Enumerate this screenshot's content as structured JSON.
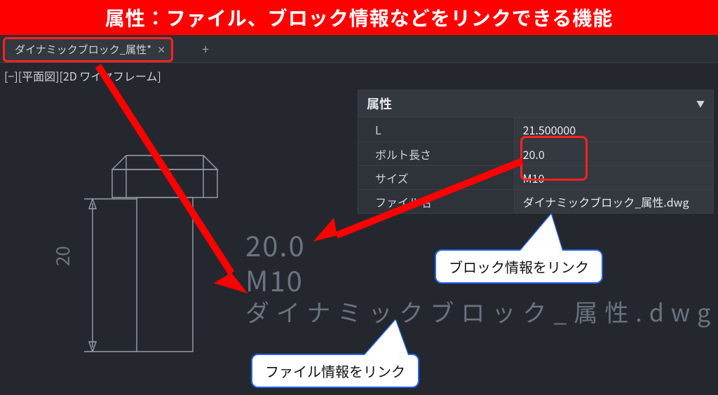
{
  "title_bar": "属性：ファイル、ブロック情報などをリンクできる機能",
  "tabs": {
    "items": [
      {
        "label": "ダイナミックブロック_属性*"
      }
    ],
    "add": "+"
  },
  "viewport_label": "[−][平面図][2D ワイヤフレーム]",
  "attr_panel": {
    "title": "属性",
    "rows": [
      {
        "key": "L",
        "val": "21.500000"
      },
      {
        "key": "ボルト長さ",
        "val": "20.0"
      },
      {
        "key": "サイズ",
        "val": "M10"
      },
      {
        "key": "ファイル名",
        "val": "ダイナミックブロック_属性.dwg"
      }
    ]
  },
  "drawing": {
    "val_20": "20.0",
    "val_m10": "M10",
    "val_file": "ダイナミックブロック_属性.dwg",
    "dim_20": "20"
  },
  "bubbles": {
    "block": "ブロック情報をリンク",
    "file": "ファイル情報をリンク"
  },
  "icons": {
    "close": "✕",
    "caret": "▼"
  }
}
